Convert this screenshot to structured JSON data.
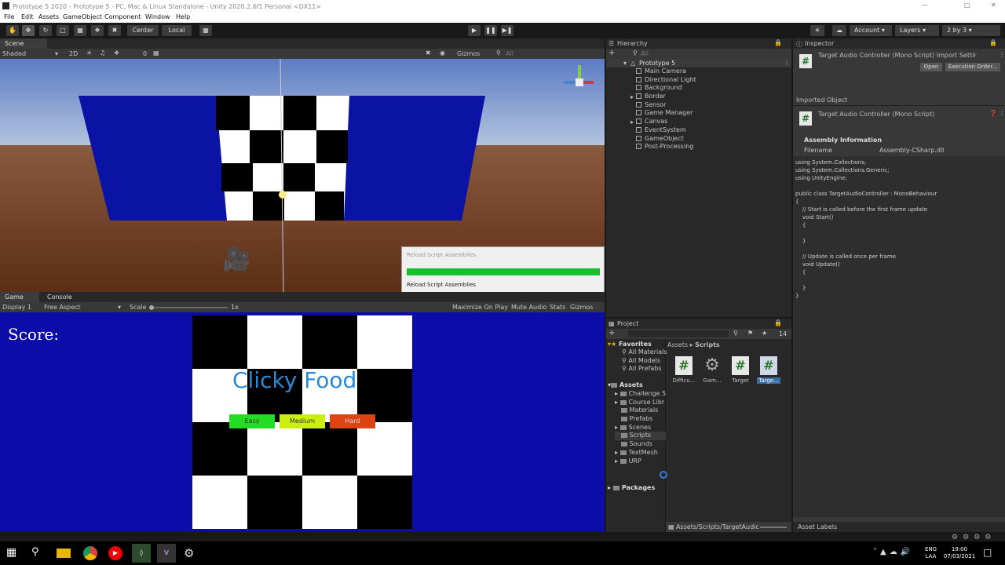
{
  "titlebar": {
    "title": "Prototype 5 2020 - Prototype 5 - PC, Mac & Linux Standalone - Unity 2020.2.6f1 Personal <DX11>"
  },
  "menu": [
    "File",
    "Edit",
    "Assets",
    "GameObject",
    "Component",
    "Window",
    "Help"
  ],
  "toolbar": {
    "center": "Center",
    "local": "Local",
    "account": "Account",
    "layers": "Layers",
    "layout": "2 by 3"
  },
  "scene": {
    "tab": "Scene",
    "shading": "Shaded",
    "mode2d": "2D",
    "gizmos": "Gizmos",
    "search": "All",
    "fx_count": "0"
  },
  "reload_dialog": {
    "title": "Reload Script Assemblies",
    "label": "Reload Script Assemblies",
    "progress": 1.0
  },
  "game": {
    "tab": "Game",
    "console_tab": "Console",
    "display": "Display 1",
    "aspect": "Free Aspect",
    "scale_label": "Scale",
    "scale_value": "1x",
    "maximize": "Maximize On Play",
    "mute": "Mute Audio",
    "stats": "Stats",
    "gizmos": "Gizmos",
    "score": "Score:",
    "heading": "Clicky Food",
    "buttons": [
      {
        "label": "Easy",
        "color": "#22dd22"
      },
      {
        "label": "Medium",
        "color": "#ccee11"
      },
      {
        "label": "Hard",
        "color": "#dd4411"
      }
    ]
  },
  "hierarchy": {
    "tab": "Hierarchy",
    "search": "All",
    "root": "Prototype 5",
    "items": [
      "Main Camera",
      "Directional Light",
      "Background",
      "Border",
      "Sensor",
      "Game Manager",
      "Canvas",
      "EventSystem",
      "GameObject",
      "Post-Processing"
    ]
  },
  "project": {
    "tab": "Project",
    "count": "14",
    "favorites": "Favorites",
    "fav_items": [
      "All Materials",
      "All Models",
      "All Prefabs"
    ],
    "assets": "Assets",
    "folders": [
      "Challenge 5",
      "Course Libr",
      "Materials",
      "Prefabs",
      "Scenes",
      "Scripts",
      "Sounds",
      "TextMesh",
      "URP"
    ],
    "packages": "Packages",
    "breadcrumb": [
      "Assets",
      "Scripts"
    ],
    "files": [
      {
        "name": "Difficu...",
        "icon": "csharp"
      },
      {
        "name": "Gam...",
        "icon": "gear"
      },
      {
        "name": "Target",
        "icon": "csharp"
      },
      {
        "name": "Targe...",
        "icon": "csharp"
      }
    ],
    "path": "Assets/Scripts/TargetAudic"
  },
  "inspector": {
    "tab": "Inspector",
    "header": "Target Audio Controller (Mono Script) Import Settir",
    "open": "Open",
    "exec": "Execution Order...",
    "imported": "Imported Object",
    "object_name": "Target Audio Controller (Mono Script)",
    "assembly_info": "Assembly Information",
    "filename_label": "Filename",
    "filename_value": "Assembly-CSharp.dll",
    "code": "using System.Collections;\nusing System.Collections.Generic;\nusing UnityEngine;\n\npublic class TargetAudioController : MonoBehaviour\n{\n    // Start is called before the first frame update\n    void Start()\n    {\n\n    }\n\n    // Update is called once per frame\n    void Update()\n    {\n\n    }\n}",
    "asset_labels": "Asset Labels"
  },
  "taskbar": {
    "lang1": "ENG",
    "lang2": "LAA",
    "time": "19:00",
    "date": "07/03/2021"
  },
  "colors": {
    "scene_blue": "#0a13a3",
    "game_blue": "#0c0ca8",
    "sky": "#7f9fd6",
    "ground": "#6b3a1f",
    "progress": "#17c02a",
    "accent": "#3a7bd5"
  }
}
